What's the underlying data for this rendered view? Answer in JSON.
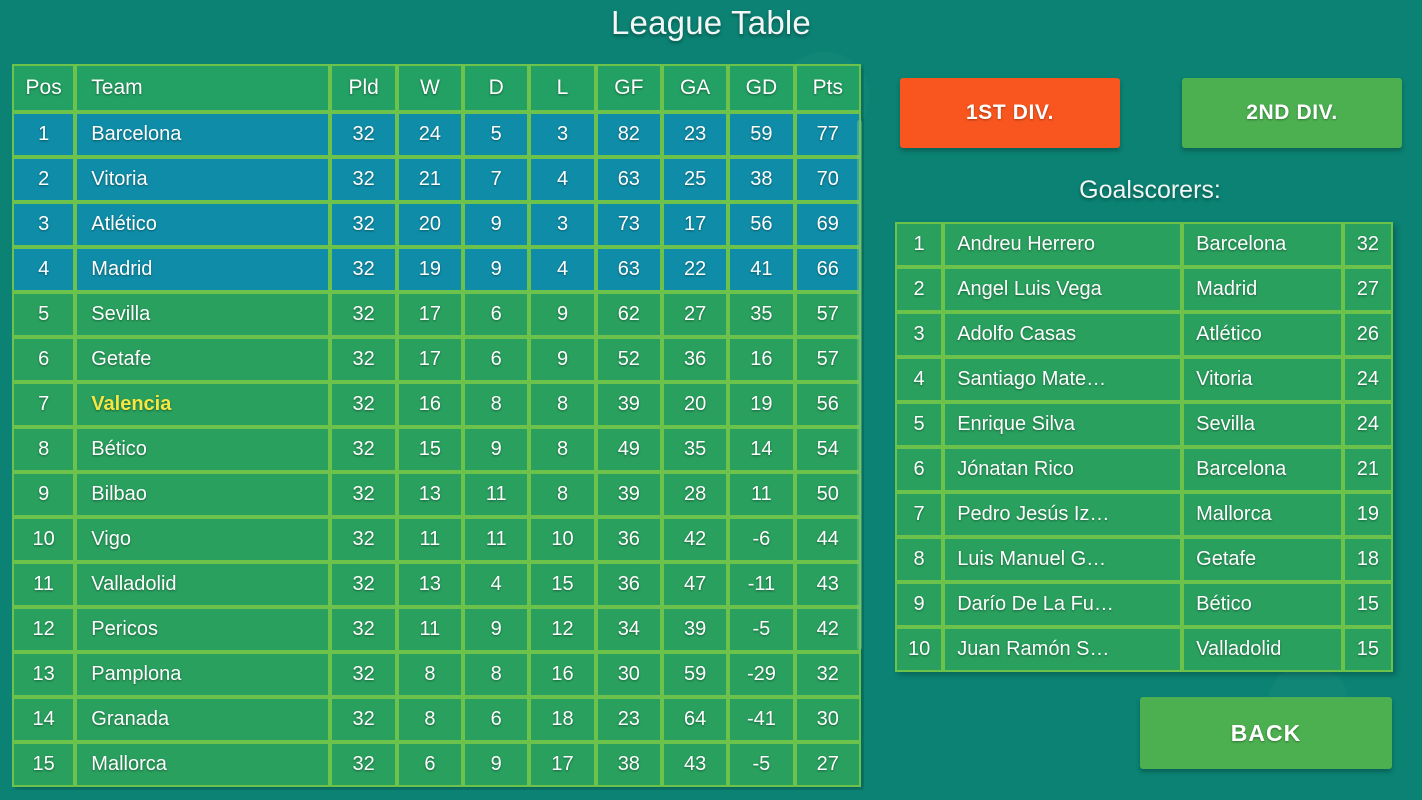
{
  "header": {
    "title": "League Table"
  },
  "league_table": {
    "columns": [
      "Pos",
      "Team",
      "Pld",
      "W",
      "D",
      "L",
      "GF",
      "GA",
      "GD",
      "Pts"
    ],
    "promotion_rows": 4,
    "highlight_team": "Valencia",
    "rows": [
      {
        "pos": "1",
        "team": "Barcelona",
        "pld": "32",
        "w": "24",
        "d": "5",
        "l": "3",
        "gf": "82",
        "ga": "23",
        "gd": "59",
        "pts": "77"
      },
      {
        "pos": "2",
        "team": "Vitoria",
        "pld": "32",
        "w": "21",
        "d": "7",
        "l": "4",
        "gf": "63",
        "ga": "25",
        "gd": "38",
        "pts": "70"
      },
      {
        "pos": "3",
        "team": "Atlético",
        "pld": "32",
        "w": "20",
        "d": "9",
        "l": "3",
        "gf": "73",
        "ga": "17",
        "gd": "56",
        "pts": "69"
      },
      {
        "pos": "4",
        "team": "Madrid",
        "pld": "32",
        "w": "19",
        "d": "9",
        "l": "4",
        "gf": "63",
        "ga": "22",
        "gd": "41",
        "pts": "66"
      },
      {
        "pos": "5",
        "team": "Sevilla",
        "pld": "32",
        "w": "17",
        "d": "6",
        "l": "9",
        "gf": "62",
        "ga": "27",
        "gd": "35",
        "pts": "57"
      },
      {
        "pos": "6",
        "team": "Getafe",
        "pld": "32",
        "w": "17",
        "d": "6",
        "l": "9",
        "gf": "52",
        "ga": "36",
        "gd": "16",
        "pts": "57"
      },
      {
        "pos": "7",
        "team": "Valencia",
        "pld": "32",
        "w": "16",
        "d": "8",
        "l": "8",
        "gf": "39",
        "ga": "20",
        "gd": "19",
        "pts": "56"
      },
      {
        "pos": "8",
        "team": "Bético",
        "pld": "32",
        "w": "15",
        "d": "9",
        "l": "8",
        "gf": "49",
        "ga": "35",
        "gd": "14",
        "pts": "54"
      },
      {
        "pos": "9",
        "team": "Bilbao",
        "pld": "32",
        "w": "13",
        "d": "11",
        "l": "8",
        "gf": "39",
        "ga": "28",
        "gd": "11",
        "pts": "50"
      },
      {
        "pos": "10",
        "team": "Vigo",
        "pld": "32",
        "w": "11",
        "d": "11",
        "l": "10",
        "gf": "36",
        "ga": "42",
        "gd": "-6",
        "pts": "44"
      },
      {
        "pos": "11",
        "team": "Valladolid",
        "pld": "32",
        "w": "13",
        "d": "4",
        "l": "15",
        "gf": "36",
        "ga": "47",
        "gd": "-11",
        "pts": "43"
      },
      {
        "pos": "12",
        "team": "Pericos",
        "pld": "32",
        "w": "11",
        "d": "9",
        "l": "12",
        "gf": "34",
        "ga": "39",
        "gd": "-5",
        "pts": "42"
      },
      {
        "pos": "13",
        "team": "Pamplona",
        "pld": "32",
        "w": "8",
        "d": "8",
        "l": "16",
        "gf": "30",
        "ga": "59",
        "gd": "-29",
        "pts": "32"
      },
      {
        "pos": "14",
        "team": "Granada",
        "pld": "32",
        "w": "8",
        "d": "6",
        "l": "18",
        "gf": "23",
        "ga": "64",
        "gd": "-41",
        "pts": "30"
      },
      {
        "pos": "15",
        "team": "Mallorca",
        "pld": "32",
        "w": "6",
        "d": "9",
        "l": "17",
        "gf": "38",
        "ga": "43",
        "gd": "-5",
        "pts": "27"
      }
    ]
  },
  "division_buttons": {
    "first_label": "1ST DIV.",
    "second_label": "2ND DIV.",
    "first_color": "#f9561f",
    "second_color": "#4cb050",
    "active": "1ST DIV."
  },
  "goalscorers": {
    "heading": "Goalscorers:",
    "rows": [
      {
        "rank": "1",
        "player": "Andreu Herrero",
        "team": "Barcelona",
        "goals": "32"
      },
      {
        "rank": "2",
        "player": "Angel Luis Vega",
        "team": "Madrid",
        "goals": "27"
      },
      {
        "rank": "3",
        "player": "Adolfo Casas",
        "team": "Atlético",
        "goals": "26"
      },
      {
        "rank": "4",
        "player": "Santiago Mate…",
        "team": "Vitoria",
        "goals": "24"
      },
      {
        "rank": "5",
        "player": "Enrique Silva",
        "team": "Sevilla",
        "goals": "24"
      },
      {
        "rank": "6",
        "player": "Jónatan Rico",
        "team": "Barcelona",
        "goals": "21"
      },
      {
        "rank": "7",
        "player": "Pedro Jesús Iz…",
        "team": "Mallorca",
        "goals": "19"
      },
      {
        "rank": "8",
        "player": "Luis Manuel G…",
        "team": "Getafe",
        "goals": "18"
      },
      {
        "rank": "9",
        "player": "Darío De La Fu…",
        "team": "Bético",
        "goals": "15"
      },
      {
        "rank": "10",
        "player": "Juan Ramón S…",
        "team": "Valladolid",
        "goals": "15"
      }
    ]
  },
  "footer": {
    "back_label": "BACK"
  },
  "theme": {
    "background": "#0b8273",
    "row_green": "#29a05e",
    "row_blue": "#0f8da8",
    "header_green": "#23a063",
    "grid_line": "#6cc24a",
    "highlight_text": "#f5e642"
  }
}
